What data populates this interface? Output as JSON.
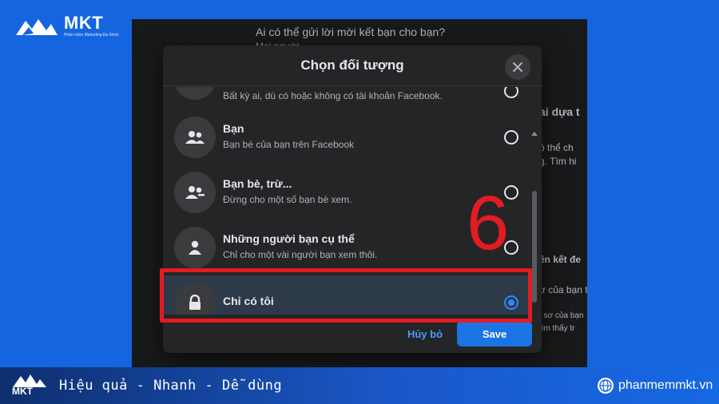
{
  "brand": {
    "name": "MKT",
    "tagline": "Phần mềm Marketing Đa Kênh"
  },
  "background": {
    "question": "Ai có thể gửi lời mời kết bạn cho bạn?",
    "question_sub": "Mọi người",
    "side_texts": [
      "ai dựa t",
      "ó thể ch",
      "g. Tìm hi",
      "ên kết đe",
      "ơ của bạn t",
      "ì sơ của bạn",
      "tìm thấy tr"
    ]
  },
  "modal": {
    "title": "Chọn đối tượng",
    "close_icon": "close-icon",
    "partial_option_desc": "Bất kỳ ai, dù có hoặc không có tài khoản Facebook.",
    "options": [
      {
        "label": "Bạn",
        "desc": "Bạn bè của bạn trên Facebook",
        "icon": "friends-icon",
        "selected": false
      },
      {
        "label": "Bạn bè, trừ...",
        "desc": "Đừng cho một số bạn bè xem.",
        "icon": "friends-except-icon",
        "selected": false
      },
      {
        "label": "Những người bạn cụ thể",
        "desc": "Chỉ cho một vài người bạn xem thôi.",
        "icon": "person-icon",
        "selected": false
      },
      {
        "label": "Chỉ có tôi",
        "desc": "",
        "icon": "lock-icon",
        "selected": true
      }
    ],
    "cancel_label": "Hủy bỏ",
    "save_label": "Save"
  },
  "annotation": {
    "step_number": "6",
    "color": "#e31b23"
  },
  "banner": {
    "brand_name": "MKT",
    "slogan": "Hiệu quả - Nhanh  - Dễ dùng",
    "website": "phanmemmkt.vn"
  },
  "colors": {
    "page_bg": "#1565e0",
    "modal_bg": "#242526",
    "accent": "#1b74e4",
    "selected_row": "#2d3a4a"
  }
}
